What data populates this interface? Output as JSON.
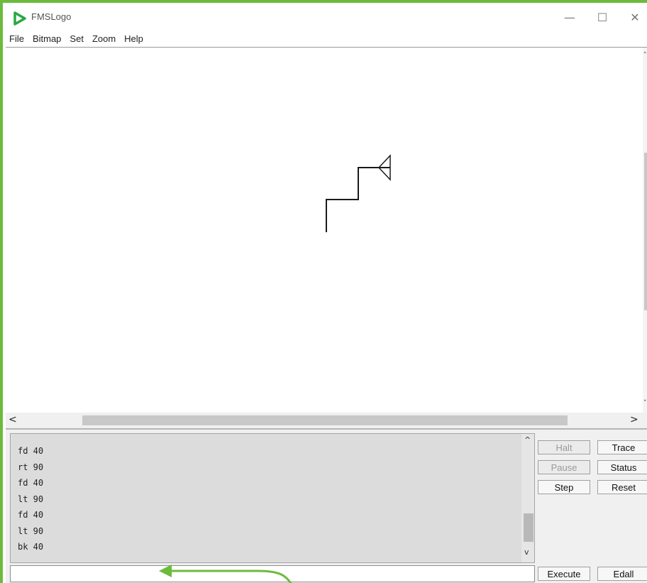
{
  "window": {
    "title": "FMSLogo",
    "controls": {
      "minimize": "—",
      "maximize": "☐",
      "close": "✕"
    }
  },
  "menu": [
    "File",
    "Bitmap",
    "Set",
    "Zoom",
    "Help"
  ],
  "scrollbars": {
    "canvas_v_up": "˄",
    "canvas_v_down": "˅",
    "canvas_h_left": "<",
    "canvas_h_right": ">",
    "console_up": "^",
    "console_down": "v"
  },
  "console": {
    "lines": [
      "fd 40",
      "rt 90",
      "fd 40",
      "lt 90",
      "fd 40",
      "lt 90",
      "bk 40"
    ]
  },
  "buttons": {
    "halt": "Halt",
    "trace": "Trace",
    "pause": "Pause",
    "status": "Status",
    "step": "Step",
    "reset": "Reset",
    "execute": "Execute",
    "edall": "Edall"
  },
  "input": {
    "value": "",
    "placeholder": ""
  },
  "colors": {
    "frame_accent": "#6cbb3c",
    "icon_green": "#27a844",
    "turtle_line": "#1a1a1a"
  }
}
